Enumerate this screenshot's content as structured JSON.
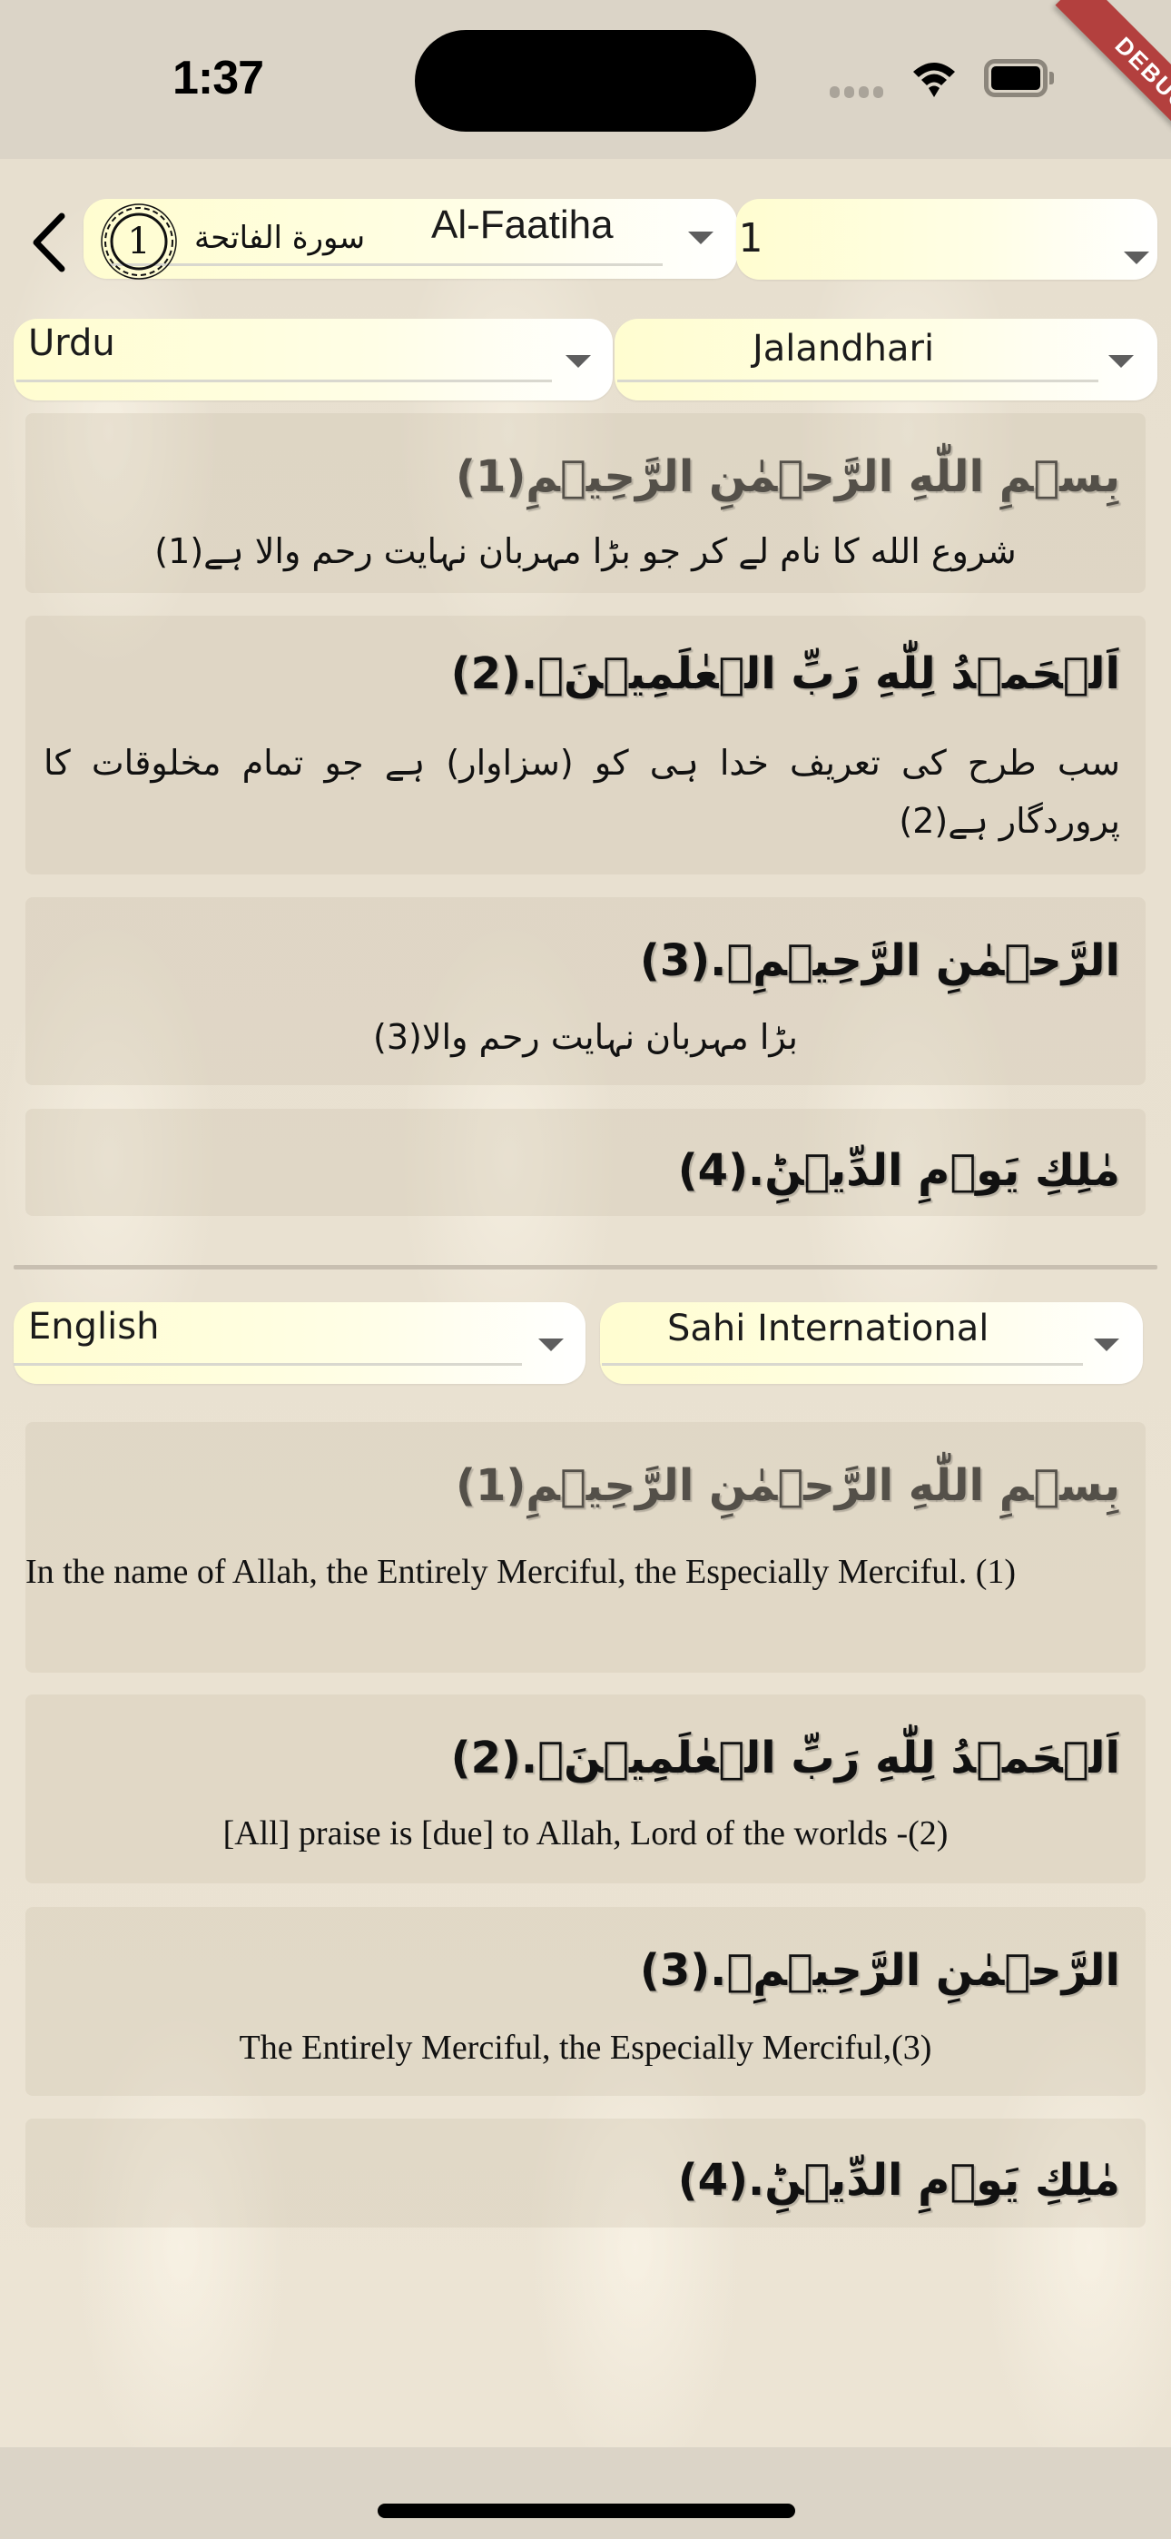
{
  "status_bar": {
    "time": "1:37",
    "debug_label": "DEBUG",
    "icons": [
      "signal-icon",
      "wifi-icon",
      "battery-icon"
    ]
  },
  "header": {
    "back_icon": "chevron-left-icon",
    "surah_number": "1",
    "surah_name_arabic": "سورة الفاتحة",
    "surah_selected": "Al-Faatiha",
    "ayah_selected": "1"
  },
  "top_panel": {
    "language_selected": "Urdu",
    "translator_selected": "Jalandhari",
    "verses": [
      {
        "arabic": "بِسۡمِ اللّٰهِ الرَّحۡمٰنِ الرَّحِيۡمِ(1)",
        "translation": "شروع الله کا نام لے کر جو بڑا مہربان نہایت رحم والا ہے(1)"
      },
      {
        "arabic": "اَلۡحَمۡدُ لِلّٰهِ رَبِّ الۡعٰلَمِيۡنَۙ.(2)",
        "translation": "سب طرح کی تعریف خدا ہی کو (سزاوار) ہے جو تمام مخلوقات کا پروردگار ہے(2)"
      },
      {
        "arabic": "الرَّحۡمٰنِ الرَّحِيۡمِۙ.(3)",
        "translation": "بڑا مہربان نہایت رحم والا(3)"
      },
      {
        "arabic": "مٰلِكِ يَوۡمِ الدِّيۡنِؕ.(4)",
        "translation": ""
      }
    ]
  },
  "bottom_panel": {
    "language_selected": "English",
    "translator_selected": "Sahi International",
    "verses": [
      {
        "arabic": "بِسۡمِ اللّٰهِ الرَّحۡمٰنِ الرَّحِيۡمِ(1)",
        "translation": "In the name of Allah, the Entirely Merciful, the Especially Merciful. (1)"
      },
      {
        "arabic": "اَلۡحَمۡدُ لِلّٰهِ رَبِّ الۡعٰلَمِيۡنَۙ.(2)",
        "translation": "[All] praise is [due] to Allah, Lord of the worlds -(2)"
      },
      {
        "arabic": "الرَّحۡمٰنِ الرَّحِيۡمِۙ.(3)",
        "translation": "The Entirely Merciful, the Especially Merciful,(3)"
      },
      {
        "arabic": "مٰلِكِ يَوۡمِ الدِّيۡنِؕ.(4)",
        "translation": ""
      }
    ]
  },
  "colors": {
    "dropdown_bg": "#fffdd0",
    "debug_banner": "#b3403e",
    "background": "#e8e0d0"
  }
}
